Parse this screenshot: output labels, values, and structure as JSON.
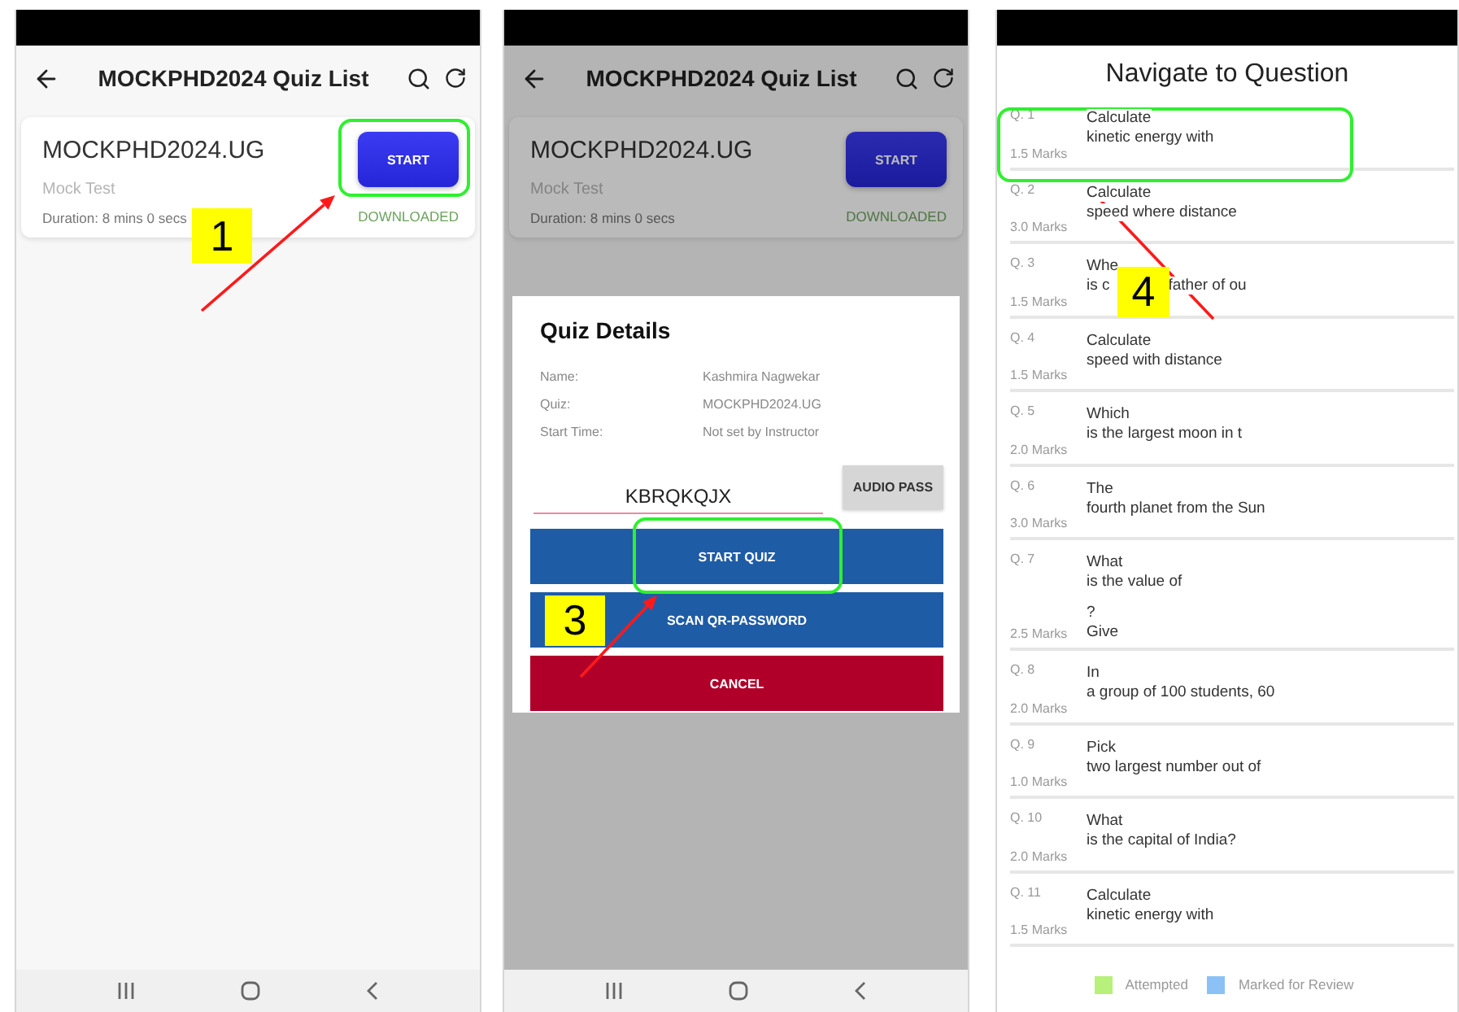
{
  "quiz_list_screen": {
    "app_bar": {
      "title": "MOCKPHD2024 Quiz List"
    },
    "quiz_card": {
      "title": "MOCKPHD2024.UG",
      "subtitle": "Mock Test",
      "duration": "Duration: 8 mins 0 secs",
      "button": "START",
      "status": "DOWNLOADED"
    }
  },
  "quiz_details_screen": {
    "app_bar": {
      "title": "MOCKPHD2024 Quiz List"
    },
    "quiz_card": {
      "title": "MOCKPHD2024.UG",
      "subtitle": "Mock Test",
      "duration": "Duration: 8 mins 0 secs",
      "button": "START",
      "status": "DOWNLOADED"
    },
    "dialog": {
      "title": "Quiz Details",
      "details": [
        {
          "label": "Name:",
          "value": "Kashmira Nagwekar"
        },
        {
          "label": "Quiz:",
          "value": "MOCKPHD2024.UG"
        },
        {
          "label": "Start Time:",
          "value": "Not set by Instructor"
        }
      ],
      "password": "KBRQKQJX",
      "audio_button": "AUDIO PASS",
      "buttons": [
        {
          "label": "START QUIZ",
          "kind": "primary"
        },
        {
          "label": "SCAN QR-PASSWORD",
          "kind": "primary"
        },
        {
          "label": "CANCEL",
          "kind": "danger"
        }
      ]
    }
  },
  "navigate_screen": {
    "title": "Navigate to Question",
    "questions": [
      {
        "number": "Q. 1",
        "marks": "1.5 Marks",
        "lines": [
          [
            "Calculate"
          ],
          [
            "kinetic energy with"
          ]
        ]
      },
      {
        "number": "Q. 2",
        "marks": "3.0 Marks",
        "lines": [
          [
            "Calculate"
          ],
          [
            "speed where distance"
          ]
        ]
      },
      {
        "number": "Q. 3",
        "marks": "1.5 Marks",
        "lines": [
          [
            "Whe"
          ],
          [
            "is c",
            "father of ou"
          ]
        ]
      },
      {
        "number": "Q. 4",
        "marks": "1.5 Marks",
        "lines": [
          [
            "Calculate"
          ],
          [
            "speed with distance"
          ]
        ]
      },
      {
        "number": "Q. 5",
        "marks": "2.0 Marks",
        "lines": [
          [
            "Which"
          ],
          [
            "is the largest moon in t"
          ]
        ]
      },
      {
        "number": "Q. 6",
        "marks": "3.0 Marks",
        "lines": [
          [
            "The"
          ],
          [
            "fourth planet from the Sun"
          ]
        ]
      },
      {
        "number": "Q. 7",
        "marks": "2.5 Marks",
        "lines": [
          [
            "What"
          ],
          [
            "is the value of"
          ],
          [
            "?"
          ],
          [
            "Give"
          ]
        ]
      },
      {
        "number": "Q. 8",
        "marks": "2.0 Marks",
        "lines": [
          [
            "In"
          ],
          [
            "a group of 100 students, 60"
          ]
        ]
      },
      {
        "number": "Q. 9",
        "marks": "1.0 Marks",
        "lines": [
          [
            "Pick"
          ],
          [
            "two largest number out of"
          ]
        ]
      },
      {
        "number": "Q. 10",
        "marks": "2.0 Marks",
        "lines": [
          [
            "What"
          ],
          [
            "is the capital of India?"
          ]
        ]
      },
      {
        "number": "Q. 11",
        "marks": "1.5 Marks",
        "lines": [
          [
            "Calculate"
          ],
          [
            "kinetic energy with"
          ]
        ]
      }
    ],
    "legend": [
      {
        "label": "Attempted",
        "color": "#b8f07c"
      },
      {
        "label": "Marked for Review",
        "color": "#8cc1f5"
      }
    ]
  },
  "annotations": [
    {
      "number": "1"
    },
    {
      "number": "3"
    },
    {
      "number": "4"
    }
  ]
}
